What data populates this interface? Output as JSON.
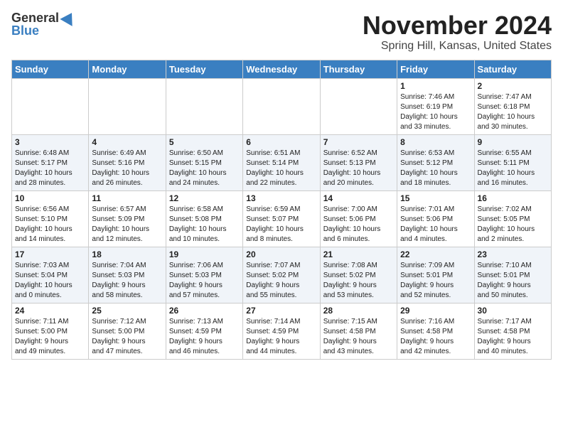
{
  "header": {
    "logo_general": "General",
    "logo_blue": "Blue",
    "month": "November 2024",
    "location": "Spring Hill, Kansas, United States"
  },
  "weekdays": [
    "Sunday",
    "Monday",
    "Tuesday",
    "Wednesday",
    "Thursday",
    "Friday",
    "Saturday"
  ],
  "weeks": [
    [
      {
        "day": "",
        "text": ""
      },
      {
        "day": "",
        "text": ""
      },
      {
        "day": "",
        "text": ""
      },
      {
        "day": "",
        "text": ""
      },
      {
        "day": "",
        "text": ""
      },
      {
        "day": "1",
        "text": "Sunrise: 7:46 AM\nSunset: 6:19 PM\nDaylight: 10 hours\nand 33 minutes."
      },
      {
        "day": "2",
        "text": "Sunrise: 7:47 AM\nSunset: 6:18 PM\nDaylight: 10 hours\nand 30 minutes."
      }
    ],
    [
      {
        "day": "3",
        "text": "Sunrise: 6:48 AM\nSunset: 5:17 PM\nDaylight: 10 hours\nand 28 minutes."
      },
      {
        "day": "4",
        "text": "Sunrise: 6:49 AM\nSunset: 5:16 PM\nDaylight: 10 hours\nand 26 minutes."
      },
      {
        "day": "5",
        "text": "Sunrise: 6:50 AM\nSunset: 5:15 PM\nDaylight: 10 hours\nand 24 minutes."
      },
      {
        "day": "6",
        "text": "Sunrise: 6:51 AM\nSunset: 5:14 PM\nDaylight: 10 hours\nand 22 minutes."
      },
      {
        "day": "7",
        "text": "Sunrise: 6:52 AM\nSunset: 5:13 PM\nDaylight: 10 hours\nand 20 minutes."
      },
      {
        "day": "8",
        "text": "Sunrise: 6:53 AM\nSunset: 5:12 PM\nDaylight: 10 hours\nand 18 minutes."
      },
      {
        "day": "9",
        "text": "Sunrise: 6:55 AM\nSunset: 5:11 PM\nDaylight: 10 hours\nand 16 minutes."
      }
    ],
    [
      {
        "day": "10",
        "text": "Sunrise: 6:56 AM\nSunset: 5:10 PM\nDaylight: 10 hours\nand 14 minutes."
      },
      {
        "day": "11",
        "text": "Sunrise: 6:57 AM\nSunset: 5:09 PM\nDaylight: 10 hours\nand 12 minutes."
      },
      {
        "day": "12",
        "text": "Sunrise: 6:58 AM\nSunset: 5:08 PM\nDaylight: 10 hours\nand 10 minutes."
      },
      {
        "day": "13",
        "text": "Sunrise: 6:59 AM\nSunset: 5:07 PM\nDaylight: 10 hours\nand 8 minutes."
      },
      {
        "day": "14",
        "text": "Sunrise: 7:00 AM\nSunset: 5:06 PM\nDaylight: 10 hours\nand 6 minutes."
      },
      {
        "day": "15",
        "text": "Sunrise: 7:01 AM\nSunset: 5:06 PM\nDaylight: 10 hours\nand 4 minutes."
      },
      {
        "day": "16",
        "text": "Sunrise: 7:02 AM\nSunset: 5:05 PM\nDaylight: 10 hours\nand 2 minutes."
      }
    ],
    [
      {
        "day": "17",
        "text": "Sunrise: 7:03 AM\nSunset: 5:04 PM\nDaylight: 10 hours\nand 0 minutes."
      },
      {
        "day": "18",
        "text": "Sunrise: 7:04 AM\nSunset: 5:03 PM\nDaylight: 9 hours\nand 58 minutes."
      },
      {
        "day": "19",
        "text": "Sunrise: 7:06 AM\nSunset: 5:03 PM\nDaylight: 9 hours\nand 57 minutes."
      },
      {
        "day": "20",
        "text": "Sunrise: 7:07 AM\nSunset: 5:02 PM\nDaylight: 9 hours\nand 55 minutes."
      },
      {
        "day": "21",
        "text": "Sunrise: 7:08 AM\nSunset: 5:02 PM\nDaylight: 9 hours\nand 53 minutes."
      },
      {
        "day": "22",
        "text": "Sunrise: 7:09 AM\nSunset: 5:01 PM\nDaylight: 9 hours\nand 52 minutes."
      },
      {
        "day": "23",
        "text": "Sunrise: 7:10 AM\nSunset: 5:01 PM\nDaylight: 9 hours\nand 50 minutes."
      }
    ],
    [
      {
        "day": "24",
        "text": "Sunrise: 7:11 AM\nSunset: 5:00 PM\nDaylight: 9 hours\nand 49 minutes."
      },
      {
        "day": "25",
        "text": "Sunrise: 7:12 AM\nSunset: 5:00 PM\nDaylight: 9 hours\nand 47 minutes."
      },
      {
        "day": "26",
        "text": "Sunrise: 7:13 AM\nSunset: 4:59 PM\nDaylight: 9 hours\nand 46 minutes."
      },
      {
        "day": "27",
        "text": "Sunrise: 7:14 AM\nSunset: 4:59 PM\nDaylight: 9 hours\nand 44 minutes."
      },
      {
        "day": "28",
        "text": "Sunrise: 7:15 AM\nSunset: 4:58 PM\nDaylight: 9 hours\nand 43 minutes."
      },
      {
        "day": "29",
        "text": "Sunrise: 7:16 AM\nSunset: 4:58 PM\nDaylight: 9 hours\nand 42 minutes."
      },
      {
        "day": "30",
        "text": "Sunrise: 7:17 AM\nSunset: 4:58 PM\nDaylight: 9 hours\nand 40 minutes."
      }
    ]
  ]
}
